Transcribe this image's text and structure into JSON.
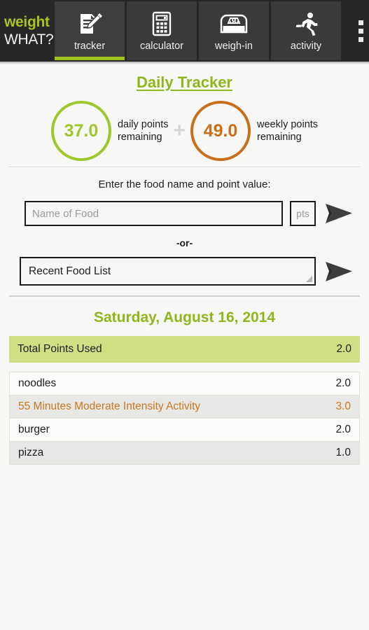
{
  "app": {
    "brand_line1": "weight",
    "brand_line2": "WHAT?",
    "brand_accent": "#a7c520"
  },
  "tabs": [
    {
      "id": "tracker",
      "label": "tracker",
      "icon": "clipboard-pencil-icon",
      "active": true
    },
    {
      "id": "calculator",
      "label": "calculator",
      "icon": "calculator-icon",
      "active": false
    },
    {
      "id": "weigh-in",
      "label": "weigh-in",
      "icon": "scale-icon",
      "active": false
    },
    {
      "id": "activity",
      "label": "activity",
      "icon": "runner-icon",
      "active": false
    }
  ],
  "overflow_menu": {
    "icon": "overflow-menu-icon",
    "label": "More options"
  },
  "page": {
    "title": "Daily Tracker",
    "title_color": "#8fb61b"
  },
  "points": {
    "daily": {
      "value": "37.0",
      "caption": "daily points\nremaining",
      "color": "#9ec72b"
    },
    "separator": "+",
    "weekly": {
      "value": "49.0",
      "caption": "weekly points\nremaining",
      "color": "#c96f1c"
    }
  },
  "form": {
    "prompt": "Enter the food name and point value:",
    "food_name_value": "",
    "food_name_placeholder": "Name of Food",
    "points_value": "",
    "points_placeholder": "pts",
    "submit_food_icon": "arrow-right-icon",
    "or_label": "-or-",
    "recent_list_selected": "Recent Food List",
    "submit_recent_icon": "arrow-right-icon"
  },
  "day": {
    "date_heading": "Saturday, August 16, 2014",
    "total_label": "Total Points Used",
    "total_value": "2.0",
    "total_bg": "#d2de83",
    "entries": [
      {
        "name": "noodles",
        "points": "2.0",
        "type": "food"
      },
      {
        "name": "55 Minutes Moderate Intensity Activity",
        "points": "3.0",
        "type": "activity"
      },
      {
        "name": "burger",
        "points": "2.0",
        "type": "food"
      },
      {
        "name": "pizza",
        "points": "1.0",
        "type": "food"
      }
    ]
  }
}
